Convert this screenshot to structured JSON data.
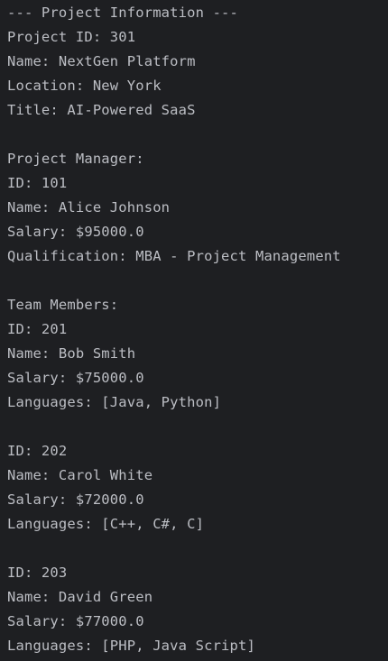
{
  "console": {
    "lines": [
      "--- Project Information ---",
      "Project ID: 301",
      "Name: NextGen Platform",
      "Location: New York",
      "Title: AI-Powered SaaS",
      "",
      "Project Manager:",
      "ID: 101",
      "Name: Alice Johnson",
      "Salary: $95000.0",
      "Qualification: MBA - Project Management",
      "",
      "Team Members:",
      "ID: 201",
      "Name: Bob Smith",
      "Salary: $75000.0",
      "Languages: [Java, Python]",
      "",
      "ID: 202",
      "Name: Carol White",
      "Salary: $72000.0",
      "Languages: [C++, C#, C]",
      "",
      "ID: 203",
      "Name: David Green",
      "Salary: $77000.0",
      "Languages: [PHP, Java Script]"
    ]
  },
  "colors": {
    "background": "#1e1f22",
    "text": "#bcbec4"
  }
}
